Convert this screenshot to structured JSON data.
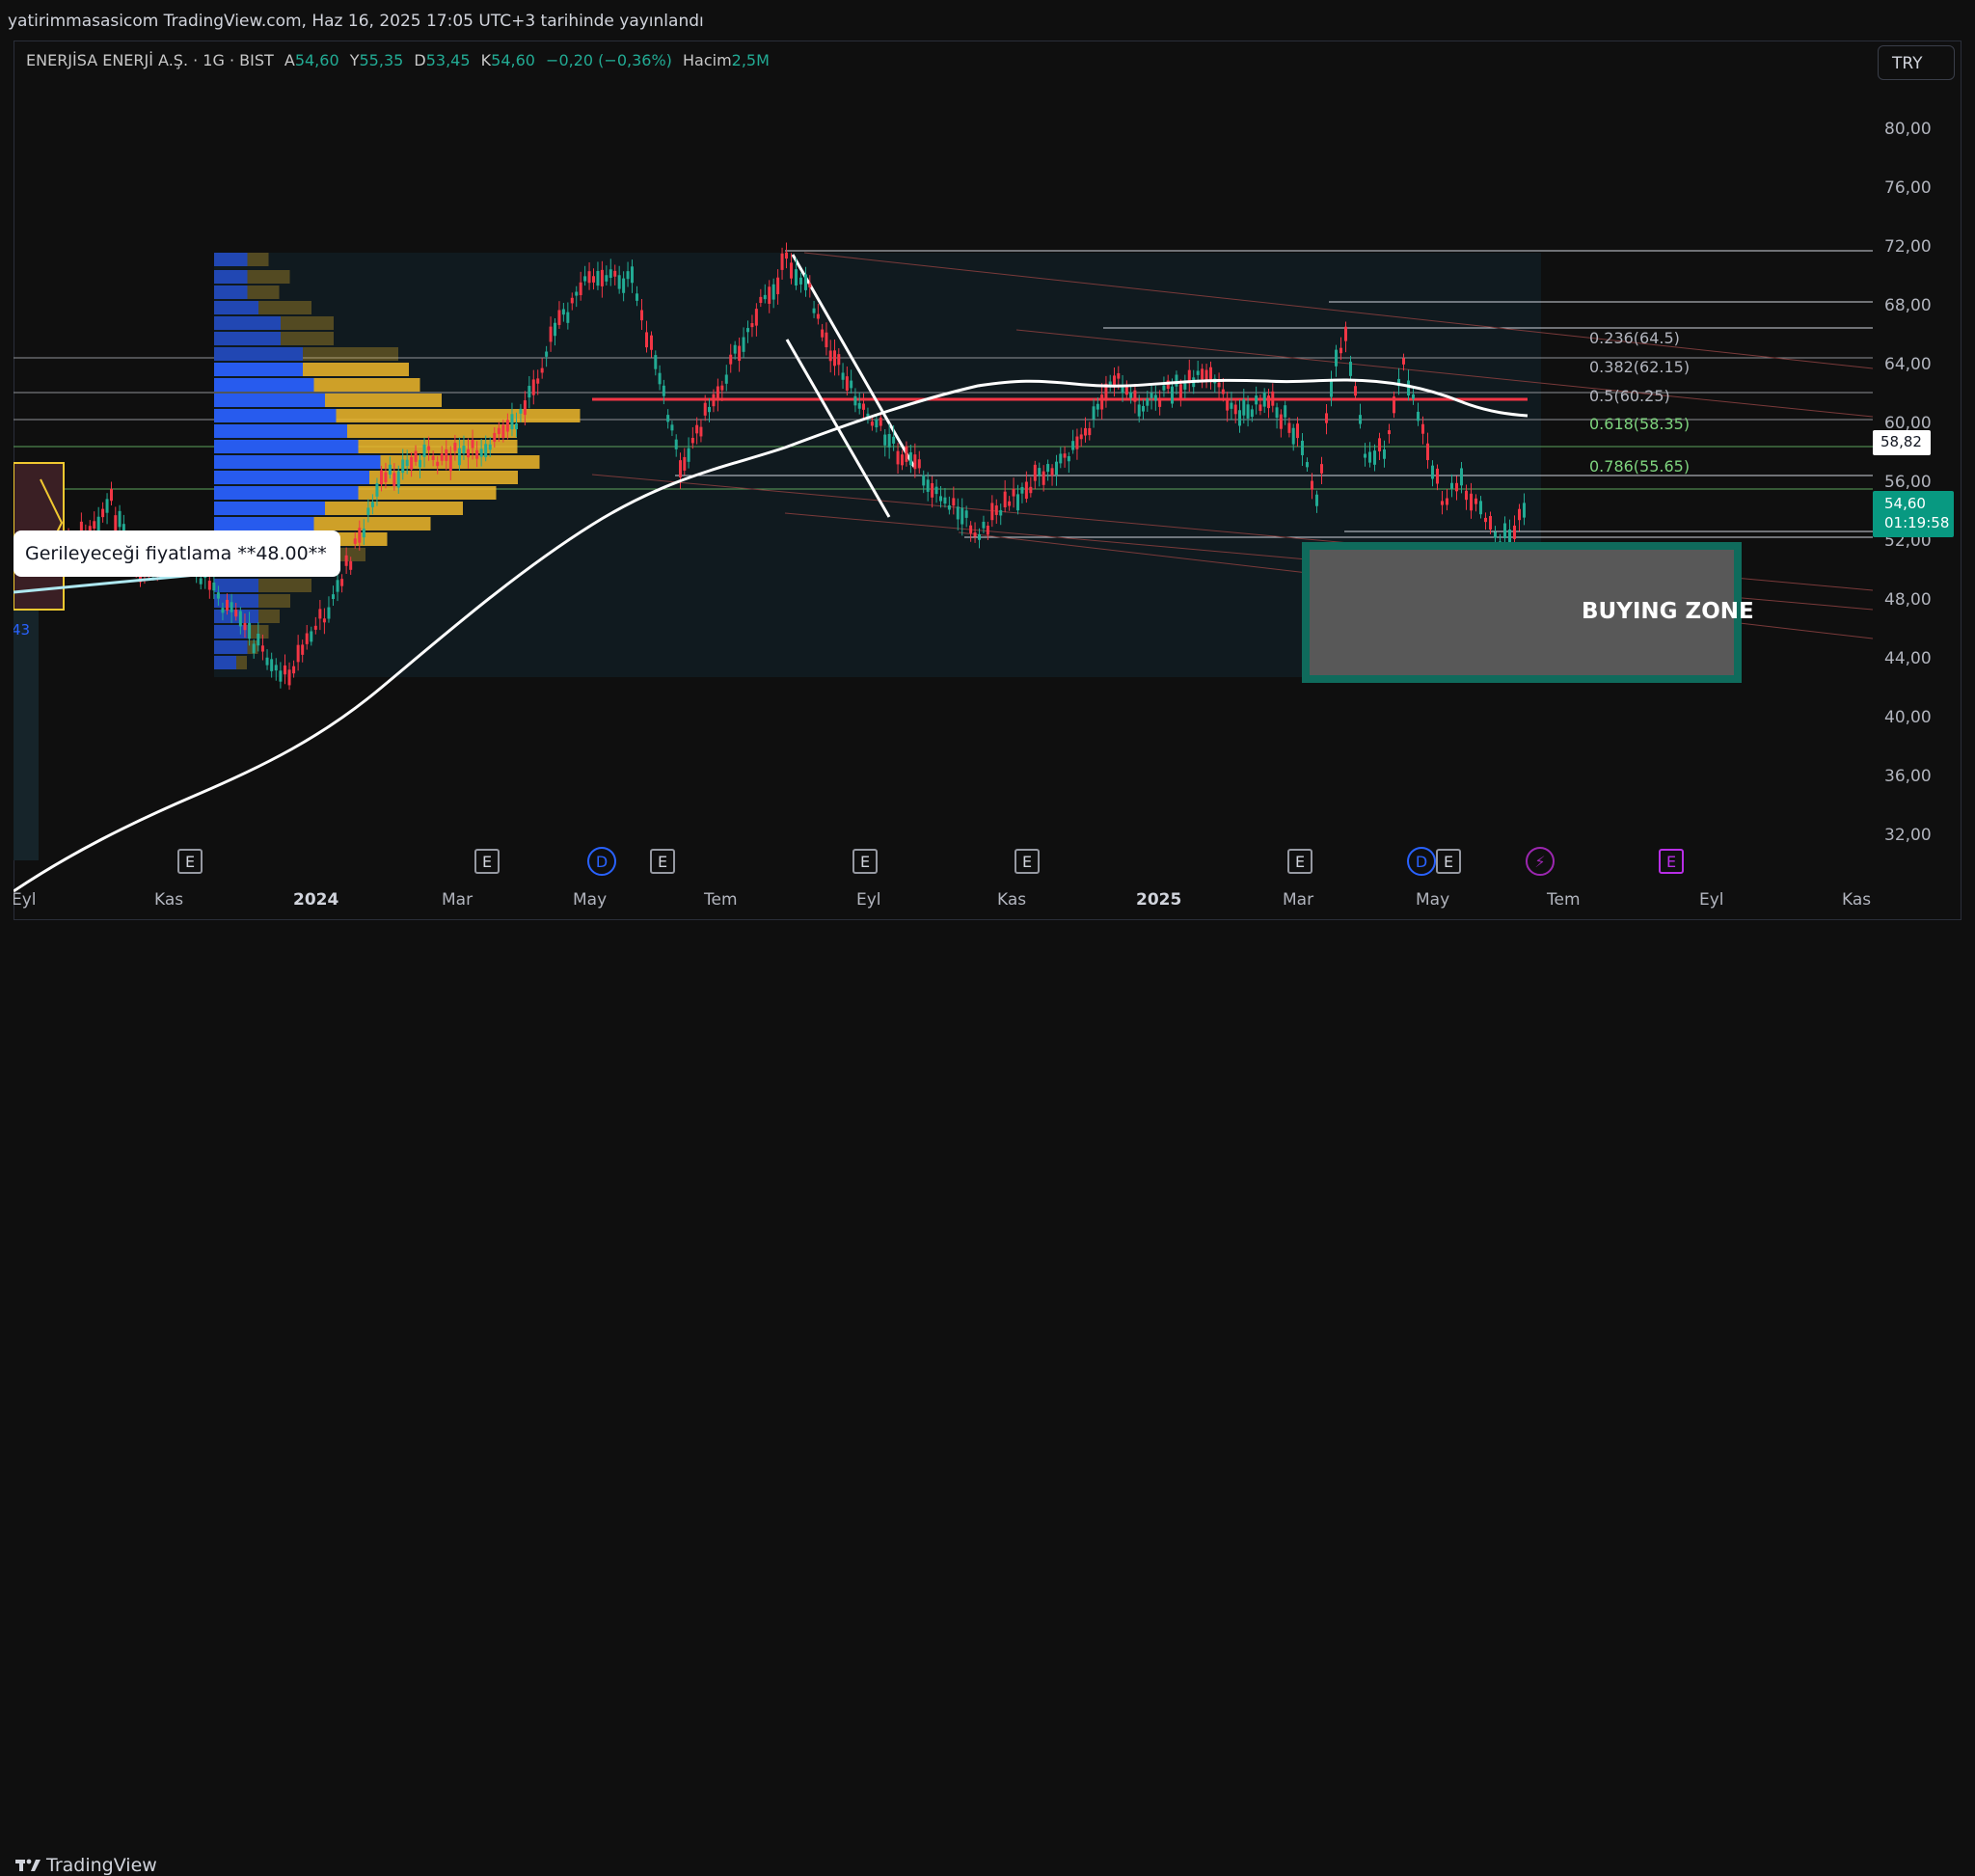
{
  "header": {
    "published_text": "yatirimmasasicom TradingView.com, Haz 16, 2025 17:05 UTC+3 tarihinde yayınlandı"
  },
  "legend": {
    "symbol": "ENERJİSA ENERJİ A.Ş. · 1G · BIST",
    "o_label": "A",
    "o_value": "54,60",
    "h_label": "Y",
    "h_value": "55,35",
    "l_label": "D",
    "l_value": "53,45",
    "c_label": "K",
    "c_value": "54,60",
    "change": "−0,20 (−0,36%)",
    "volume_label": "Hacim",
    "volume_value": "2,5M"
  },
  "currency_button": "TRY",
  "price_axis": [
    "80,00",
    "76,00",
    "72,00",
    "68,00",
    "64,00",
    "60,00",
    "56,00",
    "52,00",
    "48,00",
    "44,00",
    "40,00",
    "36,00",
    "32,00"
  ],
  "time_axis": [
    "Eyl",
    "Kas",
    "2024",
    "Mar",
    "May",
    "Tem",
    "Eyl",
    "Kas",
    "2025",
    "Mar",
    "May",
    "Tem",
    "Eyl",
    "Kas"
  ],
  "fib_levels": [
    {
      "label": "0.236(64.5)",
      "color": "#b2b5be"
    },
    {
      "label": "0.382(62.15)",
      "color": "#b2b5be"
    },
    {
      "label": "0.5(60.25)",
      "color": "#b2b5be"
    },
    {
      "label": "0.618(58.35)",
      "color": "#7ed47e"
    },
    {
      "label": "0.786(55.65)",
      "color": "#7ed47e"
    }
  ],
  "ma_tag": "58,82",
  "price_tag": {
    "price": "54,60",
    "countdown": "01:19:58"
  },
  "callout_text": "Gerileyeceği fiyatlama **48.00**",
  "left_edge_fragment": "43",
  "zone_label": "BUYING ZONE",
  "event_markers": [
    {
      "letter": "E",
      "kind": "earnings"
    },
    {
      "letter": "E",
      "kind": "earnings"
    },
    {
      "letter": "D",
      "kind": "dividend"
    },
    {
      "letter": "E",
      "kind": "earnings"
    },
    {
      "letter": "E",
      "kind": "earnings"
    },
    {
      "letter": "E",
      "kind": "earnings"
    },
    {
      "letter": "E",
      "kind": "earnings"
    },
    {
      "letter": "D",
      "kind": "dividend"
    },
    {
      "letter": "E",
      "kind": "earnings"
    },
    {
      "letter": "⚡",
      "kind": "split"
    },
    {
      "letter": "E",
      "kind": "earnings-upcoming"
    }
  ],
  "colors": {
    "up": "#22ab94",
    "down": "#f23645",
    "ma": "#ffffff",
    "fib_red": "#f23645",
    "zone": "#089981",
    "vp_up": "#2962ff",
    "vp_down": "#f0b92a"
  },
  "footer": {
    "brand": "TradingView"
  }
}
